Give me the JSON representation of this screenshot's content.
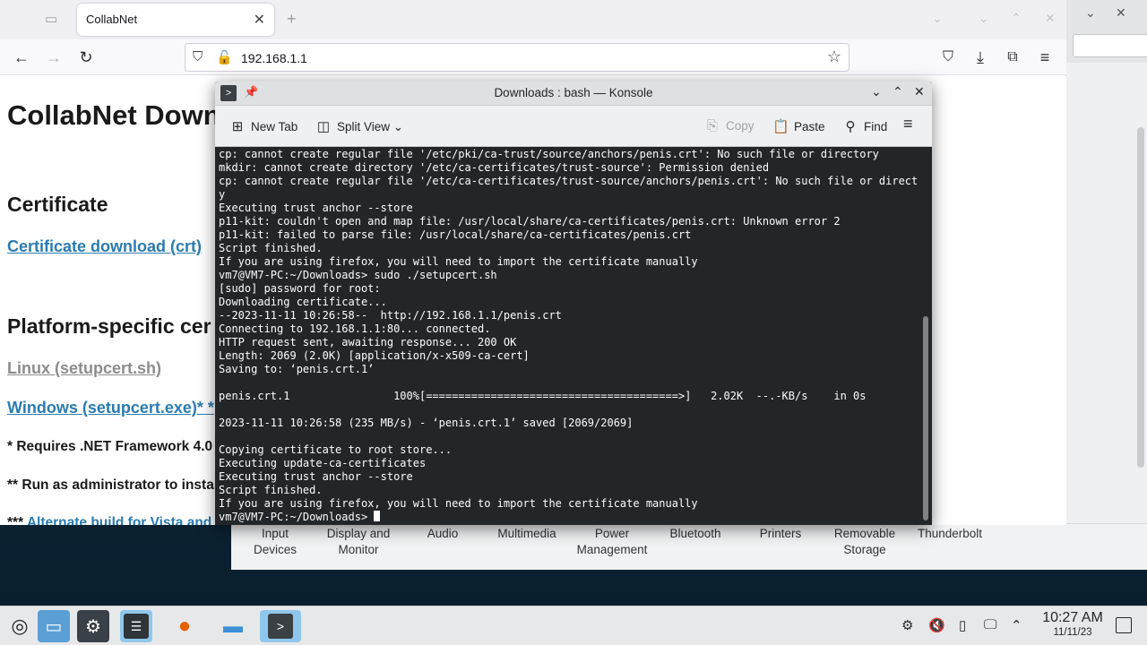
{
  "browser": {
    "tab_title": "CollabNet",
    "url": "192.168.1.1",
    "page": {
      "heading": "CollabNet Down",
      "section_certificate": "Certificate",
      "certificate_link": "Certificate download (crt)",
      "section_platform": "Platform-specific cer",
      "linux_link": "Linux (setupcert.sh)",
      "windows_link": "Windows (setupcert.exe)* *",
      "note_framework": "* Requires .NET Framework 4.0",
      "note_admin": "** Run as administrator to instal",
      "note_alt_prefix": "***",
      "note_alt_link": "Alternate build for Vista and"
    }
  },
  "settings": {
    "categories": [
      {
        "line1": "Input",
        "line2": "Devices"
      },
      {
        "line1": "Display and",
        "line2": "Monitor"
      },
      {
        "line1": "Audio",
        "line2": ""
      },
      {
        "line1": "Multimedia",
        "line2": ""
      },
      {
        "line1": "Power",
        "line2": "Management"
      },
      {
        "line1": "Bluetooth",
        "line2": ""
      },
      {
        "line1": "Printers",
        "line2": ""
      },
      {
        "line1": "Removable",
        "line2": "Storage"
      },
      {
        "line1": "Thunderbolt",
        "line2": ""
      }
    ]
  },
  "konsole": {
    "title": "Downloads : bash — Konsole",
    "toolbar": {
      "new_tab": "New Tab",
      "split_view": "Split View",
      "copy": "Copy",
      "paste": "Paste",
      "find": "Find"
    },
    "lines": [
      "cp: cannot create regular file '/etc/pki/ca-trust/source/anchors/penis.crt': No such file or directory",
      "mkdir: cannot create directory '/etc/ca-certificates/trust-source': Permission denied",
      "cp: cannot create regular file '/etc/ca-certificates/trust-source/anchors/penis.crt': No such file or director",
      "y",
      "Executing trust anchor --store",
      "p11-kit: couldn't open and map file: /usr/local/share/ca-certificates/penis.crt: Unknown error 2",
      "p11-kit: failed to parse file: /usr/local/share/ca-certificates/penis.crt",
      "Script finished.",
      "If you are using firefox, you will need to import the certificate manually",
      "vm7@VM7-PC:~/Downloads> sudo ./setupcert.sh",
      "[sudo] password for root:",
      "Downloading certificate...",
      "--2023-11-11 10:26:58--  http://192.168.1.1/penis.crt",
      "Connecting to 192.168.1.1:80... connected.",
      "HTTP request sent, awaiting response... 200 OK",
      "Length: 2069 (2.0K) [application/x-x509-ca-cert]",
      "Saving to: ‘penis.crt.1’",
      "",
      "penis.crt.1                100%[=======================================>]   2.02K  --.-KB/s    in 0s",
      "",
      "2023-11-11 10:26:58 (235 MB/s) - ‘penis.crt.1’ saved [2069/2069]",
      "",
      "Copying certificate to root store...",
      "Executing update-ca-certificates",
      "Executing trust anchor --store",
      "Script finished.",
      "If you are using firefox, you will need to import the certificate manually"
    ],
    "prompt": "vm7@VM7-PC:~/Downloads> "
  },
  "taskbar": {
    "time": "10:27 AM",
    "date": "11/11/23"
  },
  "colors": {
    "link": "#2a7bb0",
    "visited_link": "#8c8c8c",
    "terminal_bg": "#232629",
    "terminal_fg": "#fcfcfc",
    "taskbar_active": "#8fc7ec"
  }
}
